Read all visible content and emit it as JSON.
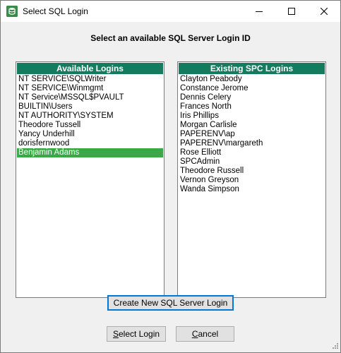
{
  "window": {
    "title": "Select SQL Login",
    "icon": "sql-db-icon"
  },
  "heading": "Select an available SQL Server Login ID",
  "available": {
    "header": "Available Logins",
    "items": [
      "NT SERVICE\\SQLWriter",
      "NT SERVICE\\Winmgmt",
      "NT Service\\MSSQL$PVAULT",
      "BUILTIN\\Users",
      "NT AUTHORITY\\SYSTEM",
      "Theodore Tussell",
      "Yancy Underhill",
      "dorisfernwood",
      "Benjamin Adams"
    ],
    "selected_index": 8
  },
  "existing": {
    "header": "Existing SPC Logins",
    "items": [
      "Clayton Peabody",
      "Constance Jerome",
      "Dennis Celery",
      "Frances North",
      "Iris Phillips",
      "Morgan Carlisle",
      "PAPERENV\\ap",
      "PAPERENV\\margareth",
      "Rose Elliott",
      "SPCAdmin",
      "Theodore Russell",
      "Vernon Greyson",
      "Wanda Simpson"
    ]
  },
  "buttons": {
    "create": "Create New SQL Server Login",
    "select_prefix": "S",
    "select_rest": "elect Login",
    "cancel_prefix": "C",
    "cancel_rest": "ancel"
  },
  "colors": {
    "header_bg": "#157b5e",
    "selection_bg": "#3aa846",
    "focus_border": "#0078d7"
  }
}
